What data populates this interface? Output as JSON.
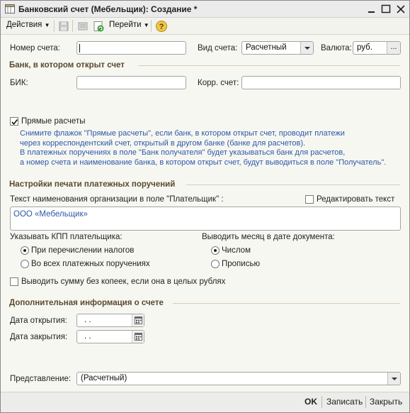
{
  "window": {
    "title": "Банковский счет (Мебельщик): Создание *"
  },
  "toolbar": {
    "actions_label": "Действия",
    "goto_label": "Перейти"
  },
  "account": {
    "number_label": "Номер счета:",
    "type_label": "Вид счета:",
    "type_value": "Расчетный",
    "currency_label": "Валюта:",
    "currency_value": "руб.",
    "currency_button": "..."
  },
  "bank_section": {
    "title": "Банк, в котором открыт счет",
    "bik_label": "БИК:",
    "corr_label": "Корр. счет:"
  },
  "direct": {
    "checkbox_label": "Прямые расчеты",
    "checked": true,
    "hint": [
      "Снимите флажок \"Прямые расчеты\", если банк, в котором открыт счет, проводит платежи",
      "через корреспондентский счет, открытый в другом банке (банке для расчетов).",
      "В платежных поручениях в поле \"Банк получателя\" будет указываться банк для расчетов,",
      "а номер счета и наименование банка, в котором открыт счет, будут выводиться в поле \"Получатель\"."
    ]
  },
  "print_section": {
    "title": "Настройки печати платежных поручений",
    "org_text_label": "Текст наименования организации в поле \"Плательщик\" :",
    "edit_text_label": "Редактировать текст",
    "edit_text_checked": false,
    "org_text_value": "ООО «Мебельщик»",
    "kpp_label": "Указывать КПП плательщика:",
    "kpp_options": [
      "При перечислении налогов",
      "Во всех платежных поручениях"
    ],
    "kpp_selected": 0,
    "month_label": "Выводить месяц в дате документа:",
    "month_options": [
      "Числом",
      "Прописью"
    ],
    "month_selected": 0,
    "no_kopecks_label": "Выводить сумму без копеек, если она в целых рублях",
    "no_kopecks_checked": false
  },
  "extra_section": {
    "title": "Дополнительная информация о счете",
    "open_date_label": "Дата открытия:",
    "open_date_value": ". .",
    "close_date_label": "Дата закрытия:",
    "close_date_value": ". ."
  },
  "representation": {
    "label": "Представление:",
    "value": "(Расчетный)"
  },
  "footer": {
    "ok": "OK",
    "save": "Записать",
    "close": "Закрыть"
  },
  "colors": {
    "section_title": "#5a4a2e",
    "hint_text": "#2d59a8",
    "section_line": "#d8cdb6"
  }
}
